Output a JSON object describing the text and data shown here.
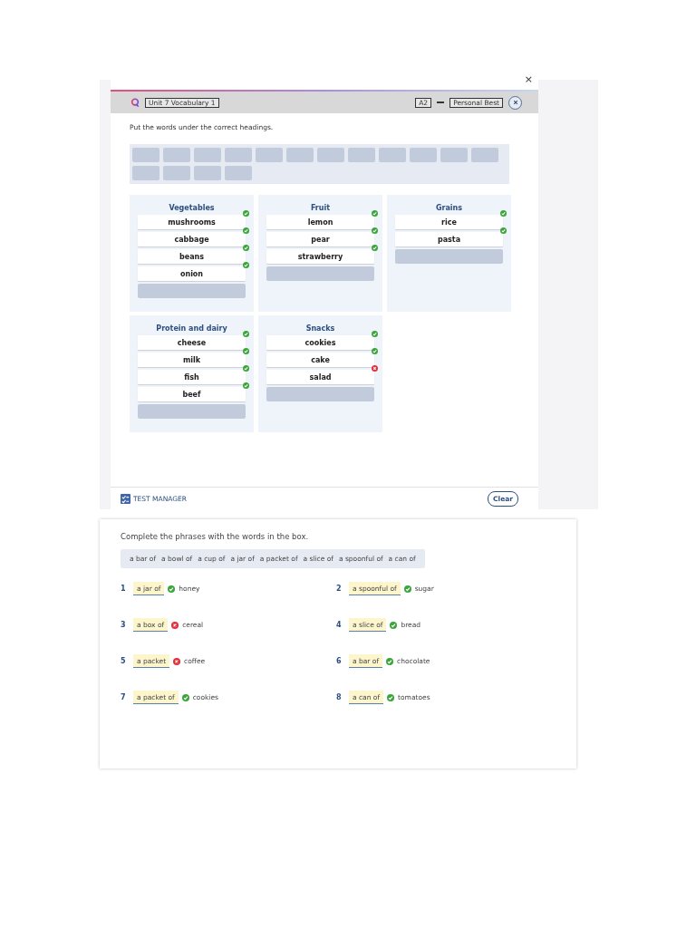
{
  "close_mark": "×",
  "header": {
    "unit_label": "Unit 7 Vocabulary 1",
    "level_label": "A2",
    "course_label": "Personal Best"
  },
  "task1": {
    "instruction": "Put the words under the correct headings.",
    "word_bank_slots": [
      {
        "filled": false
      },
      {
        "filled": false
      },
      {
        "filled": false
      },
      {
        "filled": false
      },
      {
        "filled": false
      },
      {
        "filled": false
      },
      {
        "filled": false
      },
      {
        "filled": false
      },
      {
        "filled": false
      },
      {
        "filled": false
      },
      {
        "filled": false
      },
      {
        "filled": false
      },
      {
        "filled": false
      },
      {
        "filled": false
      },
      {
        "filled": false
      },
      {
        "filled": false
      }
    ],
    "categories": [
      {
        "heading": "Vegetables",
        "items": [
          {
            "word": "mushrooms",
            "correct": true
          },
          {
            "word": "cabbage",
            "correct": true
          },
          {
            "word": "beans",
            "correct": true
          },
          {
            "word": "onion",
            "correct": true
          }
        ]
      },
      {
        "heading": "Fruit",
        "items": [
          {
            "word": "lemon",
            "correct": true
          },
          {
            "word": "pear",
            "correct": true
          },
          {
            "word": "strawberry",
            "correct": true
          }
        ]
      },
      {
        "heading": "Grains",
        "items": [
          {
            "word": "rice",
            "correct": true
          },
          {
            "word": "pasta",
            "correct": true
          }
        ]
      },
      {
        "heading": "Protein and dairy",
        "items": [
          {
            "word": "cheese",
            "correct": true
          },
          {
            "word": "milk",
            "correct": true
          },
          {
            "word": "fish",
            "correct": true
          },
          {
            "word": "beef",
            "correct": true
          }
        ]
      },
      {
        "heading": "Snacks",
        "items": [
          {
            "word": "cookies",
            "correct": true
          },
          {
            "word": "cake",
            "correct": true
          },
          {
            "word": "salad",
            "correct": false
          }
        ]
      }
    ]
  },
  "footer": {
    "brand": "TEST MANAGER",
    "clear_button": "Clear"
  },
  "task2": {
    "instruction": "Complete the phrases with the words in the box.",
    "word_box": [
      "a bar of",
      "a bowl of",
      "a cup of",
      "a jar of",
      "a packet of",
      "a slice of",
      "a spoonful of",
      "a can of"
    ],
    "items": [
      {
        "number": "1",
        "answer": "a jar of",
        "correct": true,
        "text": "honey"
      },
      {
        "number": "2",
        "answer": "a spoonful of",
        "correct": true,
        "text": "sugar"
      },
      {
        "number": "3",
        "answer": "a box of",
        "correct": false,
        "text": "cereal"
      },
      {
        "number": "4",
        "answer": "a slice of",
        "correct": true,
        "text": "bread"
      },
      {
        "number": "5",
        "answer": "a packet",
        "correct": false,
        "text": "coffee"
      },
      {
        "number": "6",
        "answer": "a bar of",
        "correct": true,
        "text": "chocolate"
      },
      {
        "number": "7",
        "answer": "a packet of",
        "correct": true,
        "text": "cookies"
      },
      {
        "number": "8",
        "answer": "a can of",
        "correct": true,
        "text": "tomatoes"
      }
    ]
  }
}
